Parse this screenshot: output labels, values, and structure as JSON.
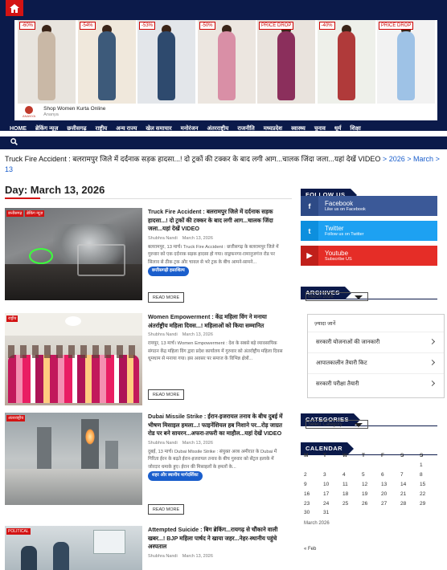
{
  "header": {
    "home_icon": "home-icon",
    "search_icon": "search-icon",
    "nav": [
      "HOME",
      "ब्रेकिंग न्यूज़",
      "छत्तीसगढ़",
      "राष्ट्रीय",
      "अन्य राज्य",
      "खेल समाचार",
      "मनोरंजन",
      "अंतरराष्ट्रीय",
      "राजनीति",
      "मध्यप्रदेश",
      "स्वास्थ्य",
      "चुनाव",
      "धूर्म",
      "शिक्षा"
    ]
  },
  "ad": {
    "badges": [
      "-60%",
      "-54%",
      "-53%",
      "-50%",
      "PRICE DROP",
      "-40%",
      "PRICE DROP"
    ],
    "title": "Shop Women Kurta Online",
    "sponsor": "Ananya",
    "logo_text": "ANANYA"
  },
  "breadcrumb": {
    "current": "Truck Fire Accident : बलरामपुर जिले में दर्दनाक सड़क हादसा...! दो ट्रकों की टक्कर के बाद लगी आग...चालक जिंदा जला...यहां देखें VIDEO",
    "sep": ">",
    "year": "2026",
    "month": "March",
    "day": "13"
  },
  "page_title": "Day: March 13, 2026",
  "posts": [
    {
      "tags": [
        "छत्तीसगढ़",
        "ब्रेकिंग न्यूज़"
      ],
      "title": "Truck Fire Accident : बलरामपुर जिले में दर्दनाक सड़क हादसा...! दो ट्रकों की टक्कर के बाद लगी आग...चालक जिंदा जला...यहां देखें VIDEO",
      "author": "Shubhra Nandi",
      "date": "March 13, 2026",
      "excerpt": "बलरामपुर, 13 मार्च। Truck Fire Accident : छत्तीसगढ़ के बलरामपुर जिले में गुरुवार को एक दर्दनाक सड़क हादसा हो गया। वाड्रफनगर-रामानुजगंज रोड पर सिलाव से ठीक ट्रक और चावल से भरे ट्रक के बीच आमने-सामने...",
      "category": "छत्तीसगढ़ी हस्तशिल्प",
      "read_more": "READ MORE"
    },
    {
      "tags": [
        "राष्ट्रीय"
      ],
      "title": "Women Empowerment : केंद्र महिला विंग ने मनाया अंतर्राष्ट्रीय महिला दिवस...! महिलाओं को किया सम्मानित",
      "author": "Shubhra Nandi",
      "date": "March 13, 2026",
      "excerpt": "रायपुर, 13 मार्च। Women Empowerment : देश के सबसे बड़े व्यावसायिक संगठन केंद्र महिला विंग द्वारा प्रदेश कार्यालय में गुरुवार को अंतर्राष्ट्रीय महिला दिवस धूमधाम से मनाया गया। इस अवसर पर समाज के विभिन्न क्षेत्रों...",
      "category": "",
      "read_more": "READ MORE"
    },
    {
      "tags": [
        "अंतरराष्ट्रीय"
      ],
      "title": "Dubai Missile Strike : ईरान-इजरायल तनाव के बीच दुबई में भीषण मिसाइल हमला...! फाइनेंशियल हब निशाने पर...रोड़ जाग्रत रोड पर बने सायरन...अफरा-तफरी का माहौल...यहां देखें VIDEO",
      "author": "Shubhra Nandi",
      "date": "March 13, 2026",
      "excerpt": "दुबई, 13 मार्च। Dubai Missile Strike : संयुक्त अरब अमीरात के Dubai में गिरिता ईरन के बढ़ते ईरान-इजरायल तनाव के बीच गुरुवार को सेंट्रल इलाके में जोरदार धमाके हुए। ईरान की मिसाइलों के हमलों के...",
      "category": "शहर और स्थानीय मार्गदर्शिका",
      "read_more": "READ MORE"
    },
    {
      "tags": [
        "POLITICAL"
      ],
      "title": "Attempted Suicide : बिग ब्रेकिंग...रायगढ़ से चौंकाने वाली खबर...! BJP महिला पार्षद ने खाया जहर...नेहर-स्थानीय पहुंचे अस्पताल",
      "author": "Shubhra Nandi",
      "date": "March 13, 2026",
      "excerpt": "",
      "category": "",
      "read_more": ""
    }
  ],
  "sidebar": {
    "follow_title": "FOLLOW US",
    "social": [
      {
        "name": "Facebook",
        "desc": "Like us on Facebook",
        "icon": "facebook-icon",
        "glyph": "f",
        "color": "#3b5998",
        "icon_bg": "#2d4a86"
      },
      {
        "name": "Twitter",
        "desc": "Follow us on Twitter",
        "icon": "twitter-icon",
        "glyph": "t",
        "color": "#1da1f2",
        "icon_bg": "#0d8fde"
      },
      {
        "name": "Youtube",
        "desc": "Subscribe US",
        "icon": "youtube-icon",
        "glyph": "▶",
        "color": "#e52d27",
        "icon_bg": "#c01f1a"
      }
    ],
    "archives_title": "ARCHIVES",
    "archives_value": "March 2026",
    "know_more": {
      "heading": "ज़्यादा जानें",
      "items": [
        "सरकारी योजनाओं की जानकारी",
        "आपातकालीन तैयारी किट",
        "सरकारी परीक्षा तैयारी"
      ]
    },
    "categories_title": "CATEGORIES",
    "categories_value": "Select Category",
    "calendar_title": "CALENDAR",
    "calendar": {
      "days": [
        "M",
        "T",
        "W",
        "T",
        "F",
        "S",
        "S"
      ],
      "weeks": [
        [
          "",
          "",
          "",
          "",
          "",
          "",
          "1"
        ],
        [
          "2",
          "3",
          "4",
          "5",
          "6",
          "7",
          "8"
        ],
        [
          "9",
          "10",
          "11",
          "12",
          "13",
          "14",
          "15"
        ],
        [
          "16",
          "17",
          "18",
          "19",
          "20",
          "21",
          "22"
        ],
        [
          "23",
          "24",
          "25",
          "26",
          "27",
          "28",
          "29"
        ],
        [
          "30",
          "31",
          "",
          "",
          "",
          "",
          ""
        ]
      ],
      "caption": "March 2026",
      "prev": "« Feb"
    }
  },
  "colors": {
    "navy": "#0b1a4a",
    "accent": "#d31313",
    "link": "#1a5ecc"
  }
}
